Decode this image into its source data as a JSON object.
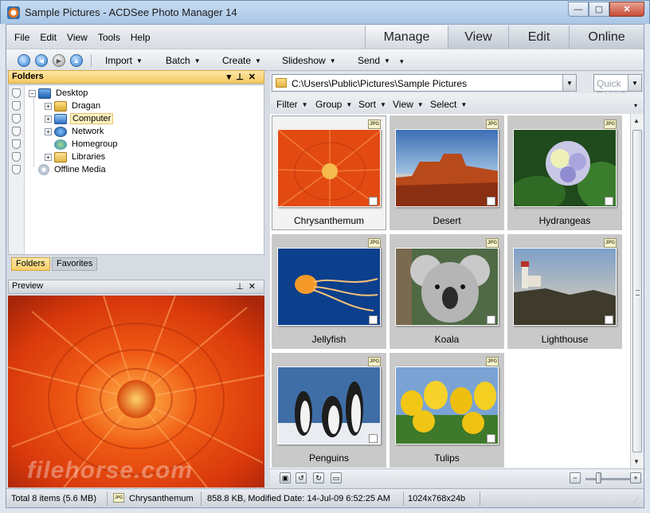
{
  "window": {
    "title": "Sample Pictures - ACDSee Photo Manager 14",
    "minimize": "—",
    "maximize": "▢",
    "close": "✕"
  },
  "menu": [
    "File",
    "Edit",
    "View",
    "Tools",
    "Help"
  ],
  "modes": [
    {
      "label": "Manage",
      "active": true
    },
    {
      "label": "View",
      "active": false
    },
    {
      "label": "Edit",
      "active": false
    },
    {
      "label": "Online",
      "active": false
    }
  ],
  "toolbar": {
    "items": [
      "Import",
      "Batch",
      "Create",
      "Slideshow",
      "Send"
    ],
    "overflow": "▾"
  },
  "folders_panel": {
    "title": "Folders",
    "tree": [
      {
        "label": "Desktop",
        "icon": "desktop-icon"
      },
      {
        "label": "Dragan",
        "icon": "user-folder-icon"
      },
      {
        "label": "Computer",
        "icon": "computer-icon",
        "selected": true
      },
      {
        "label": "Network",
        "icon": "network-icon"
      },
      {
        "label": "Homegroup",
        "icon": "homegroup-icon"
      },
      {
        "label": "Libraries",
        "icon": "libraries-icon"
      },
      {
        "label": "Offline Media",
        "icon": "disc-icon"
      }
    ],
    "tabs": [
      "Folders",
      "Favorites"
    ]
  },
  "preview_panel": {
    "title": "Preview"
  },
  "pathbar": {
    "path": "C:\\Users\\Public\\Pictures\\Sample Pictures",
    "quick_placeholder": "Quick Search"
  },
  "filterbar": [
    "Filter",
    "Group",
    "Sort",
    "View",
    "Select"
  ],
  "thumbnails": [
    {
      "label": "Chrysanthemum",
      "badge": "JPG",
      "selected": true
    },
    {
      "label": "Desert",
      "badge": "JPG"
    },
    {
      "label": "Hydrangeas",
      "badge": "JPG"
    },
    {
      "label": "Jellyfish",
      "badge": "JPG"
    },
    {
      "label": "Koala",
      "badge": "JPG"
    },
    {
      "label": "Lighthouse",
      "badge": "JPG"
    },
    {
      "label": "Penguins",
      "badge": "JPG"
    },
    {
      "label": "Tulips",
      "badge": "JPG"
    }
  ],
  "status": {
    "total": "Total 8 items  (5.6 MB)",
    "current_name": "Chrysanthemum",
    "details": "858.8 KB, Modified Date: 14-Jul-09 6:52:25 AM",
    "dimensions": "1024x768x24b"
  },
  "colors": {
    "accent": "#f5c961",
    "frame": "#d7dce3"
  }
}
